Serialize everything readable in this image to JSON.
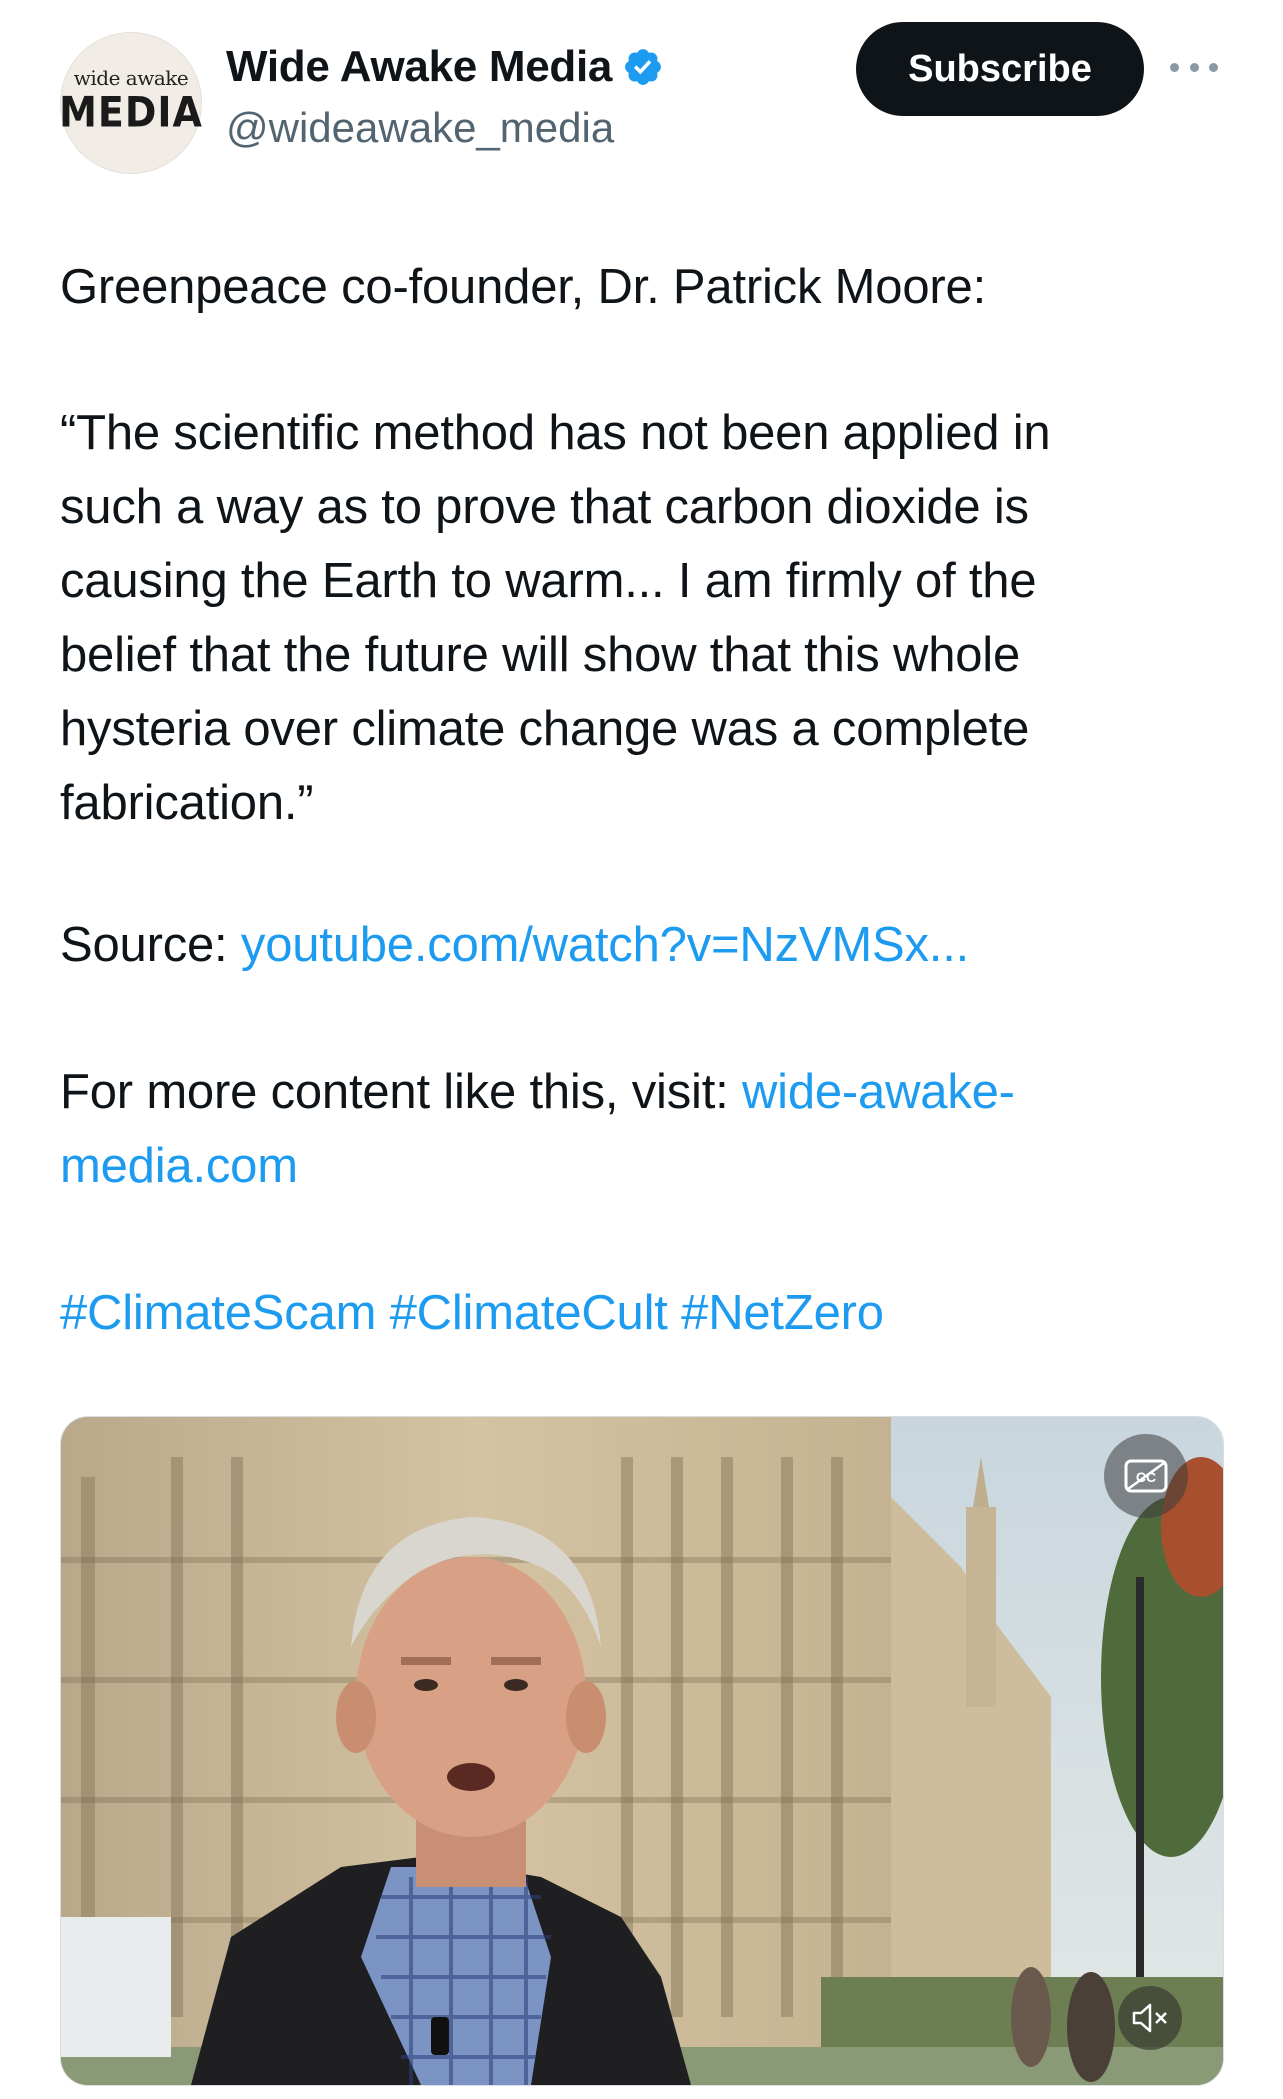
{
  "author": {
    "avatar_line1": "wide awake",
    "avatar_line2": "MEDIA",
    "display_name": "Wide Awake Media",
    "handle": "@wideawake_media",
    "verified_icon": "verified-badge-icon",
    "accent": "#1d9bf0"
  },
  "actions": {
    "subscribe_label": "Subscribe",
    "more_icon": "more-options-icon"
  },
  "post": {
    "intro": "Greenpeace co-founder, Dr. Patrick Moore:",
    "quote_lines": [
      "“The scientific method has not been applied in",
      "such a way as to prove that carbon dioxide is",
      "causing the Earth to warm... I am firmly of the",
      "belief that the future will show that this whole",
      "hysteria over climate change was a complete",
      "fabrication.”"
    ],
    "source_label": "Source: ",
    "source_link": "youtube.com/watch?v=NzVMSx...",
    "more_label": "For more content like this, visit: ",
    "more_link_line1": "wide-awake-",
    "more_link_line2": "media.com",
    "hashtags": [
      "#ClimateScam",
      "#ClimateCult",
      "#NetZero"
    ]
  },
  "video": {
    "cc_icon": "closed-captions-icon",
    "mute_icon": "muted-speaker-icon"
  }
}
